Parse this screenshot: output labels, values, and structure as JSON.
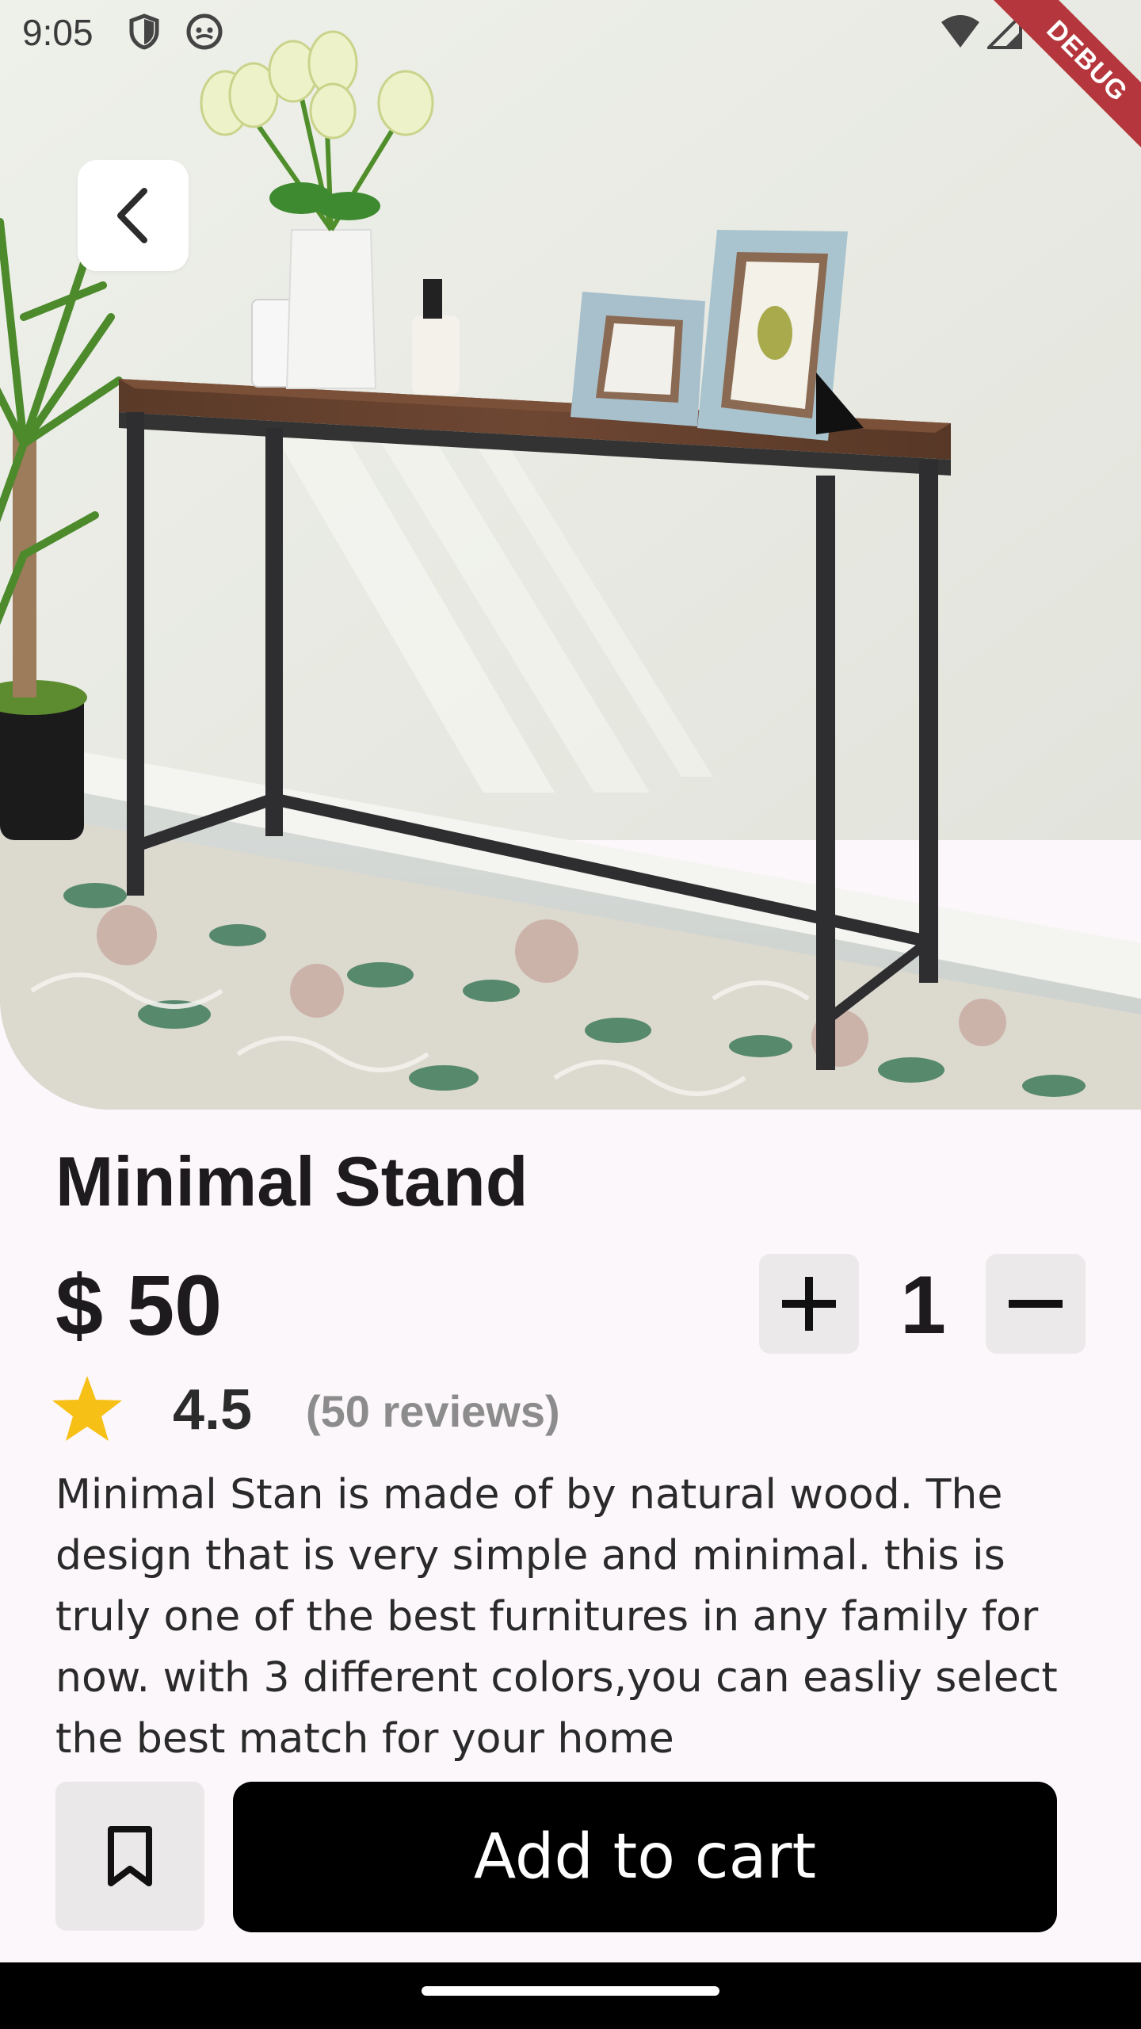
{
  "status_bar": {
    "time": "9:05",
    "icons": [
      "shield-icon",
      "android-icon",
      "wifi-icon",
      "signal-icon"
    ],
    "debug_label": "DEBUG"
  },
  "hero": {
    "image_subject": "console table with plant, vases and picture frames",
    "back_icon": "chevron-left-icon"
  },
  "product": {
    "title": "Minimal Stand",
    "price": "$ 50",
    "quantity": "1",
    "increment_icon": "plus-icon",
    "decrement_icon": "minus-icon",
    "rating": "4.5",
    "rating_icon": "star-icon",
    "reviews": "(50 reviews)",
    "description": "Minimal Stan is made of by natural wood. The design that is very simple and minimal. this is truly one of the best furnitures in any family for now. with 3 different colors,you can easliy select the best match for your home"
  },
  "actions": {
    "bookmark_icon": "bookmark-icon",
    "add_to_cart_label": "Add to cart"
  },
  "colors": {
    "background": "#fcf7fa",
    "primary_button": "#000000",
    "star": "#f6c016",
    "debug_ribbon": "#b5373d",
    "secondary_button": "#ece9ea"
  }
}
